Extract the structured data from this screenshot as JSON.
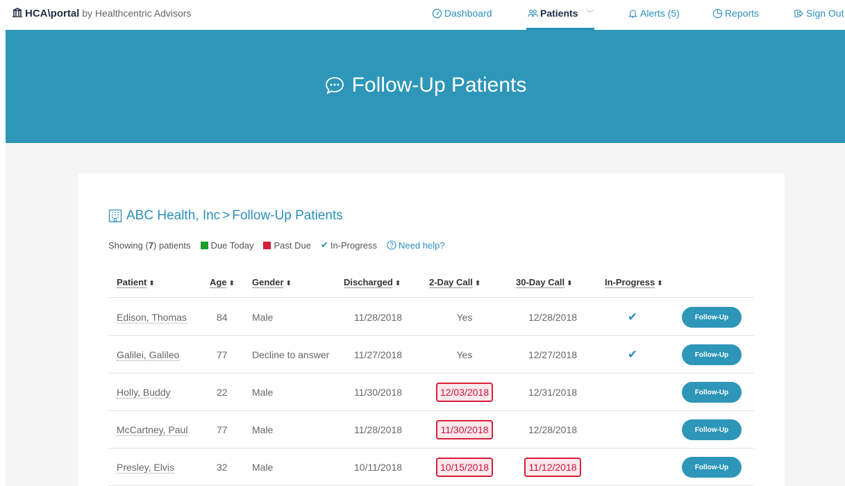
{
  "nav": {
    "brand_name": "HCA\\portal",
    "brand_by": " by Healthcentric Advisors",
    "dashboard": "Dashboard",
    "patients": "Patients",
    "alerts": "Alerts (5)",
    "reports": "Reports",
    "sign_out": "Sign Out"
  },
  "hero": {
    "title": "Follow-Up Patients"
  },
  "breadcrumb": {
    "org": "ABC Health, Inc",
    "separator": ">",
    "page": "Follow-Up Patients"
  },
  "legend": {
    "showing_prefix": "Showing (",
    "count": "7",
    "showing_suffix": ") patients",
    "due_today": "Due Today",
    "past_due": "Past Due",
    "in_progress": "In-Progress",
    "help": "Need help?"
  },
  "table": {
    "headers": [
      "Patient",
      "Age",
      "Gender",
      "Discharged",
      "2-Day Call",
      "30-Day Call",
      "In-Progress"
    ],
    "rows": [
      {
        "patient": "Edison, Thomas",
        "age": "84",
        "gender": "Male",
        "discharged": "11/28/2018",
        "call2": "Yes",
        "call2_past_due": false,
        "call30": "12/28/2018",
        "call30_past_due": false,
        "in_progress": true,
        "action": "Follow-Up"
      },
      {
        "patient": "Galilei, Galileo",
        "age": "77",
        "gender": "Decline to answer",
        "discharged": "11/27/2018",
        "call2": "Yes",
        "call2_past_due": false,
        "call30": "12/27/2018",
        "call30_past_due": false,
        "in_progress": true,
        "action": "Follow-Up"
      },
      {
        "patient": "Holly, Buddy",
        "age": "22",
        "gender": "Male",
        "discharged": "11/30/2018",
        "call2": "12/03/2018",
        "call2_past_due": true,
        "call30": "12/31/2018",
        "call30_past_due": false,
        "in_progress": false,
        "action": "Follow-Up"
      },
      {
        "patient": "McCartney, Paul",
        "age": "77",
        "gender": "Male",
        "discharged": "11/28/2018",
        "call2": "11/30/2018",
        "call2_past_due": true,
        "call30": "12/28/2018",
        "call30_past_due": false,
        "in_progress": false,
        "action": "Follow-Up"
      },
      {
        "patient": "Presley, Elvis",
        "age": "32",
        "gender": "Male",
        "discharged": "10/11/2018",
        "call2": "10/15/2018",
        "call2_past_due": true,
        "call30": "11/12/2018",
        "call30_past_due": true,
        "in_progress": false,
        "action": "Follow-Up"
      }
    ]
  },
  "colors": {
    "accent": "#2e96b8",
    "due_today": "#1b9e2a",
    "past_due": "#d61f3a"
  }
}
